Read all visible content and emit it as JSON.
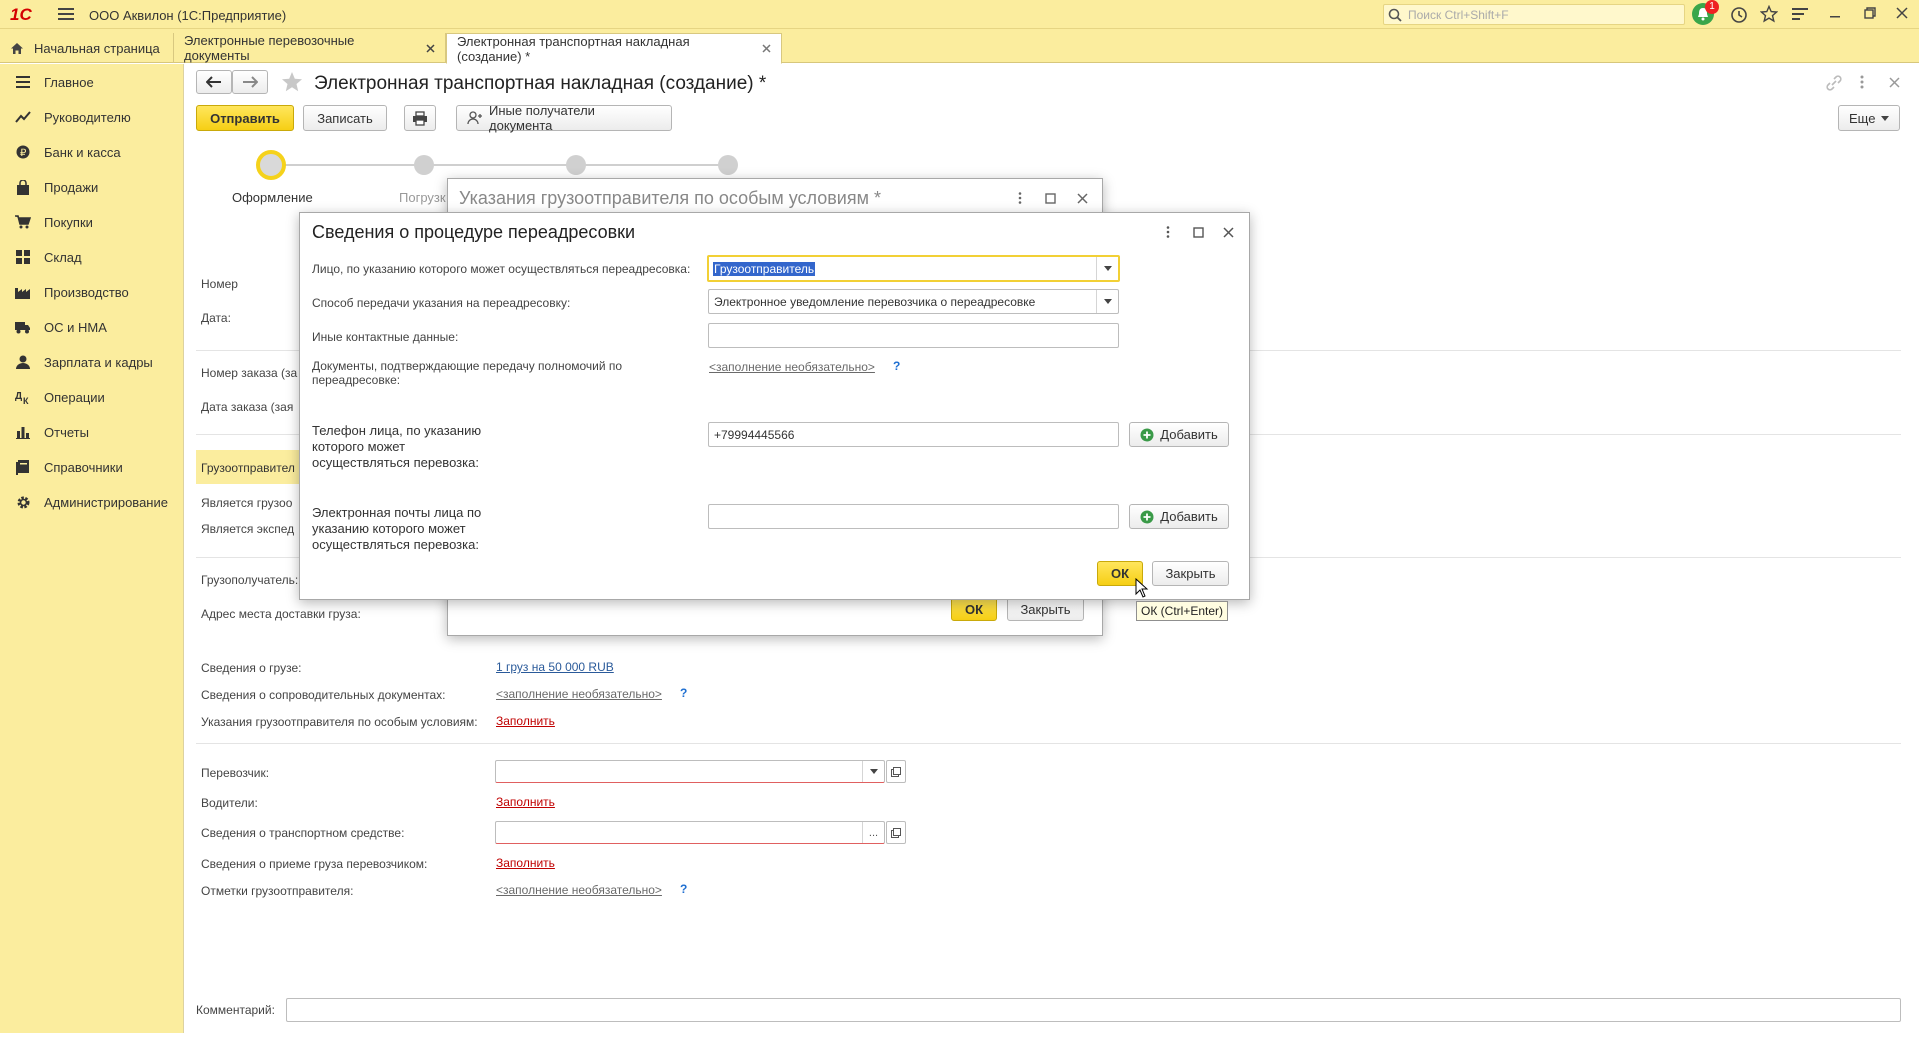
{
  "app": {
    "title": "ООО Аквилон  (1С:Предприятие)",
    "search_placeholder": "Поиск Ctrl+Shift+F",
    "notification_count": "1",
    "logo": "1С"
  },
  "tabs": [
    {
      "label": "Начальная страница"
    },
    {
      "label": "Электронные перевозочные документы"
    },
    {
      "label": "Электронная транспортная накладная (создание) *"
    }
  ],
  "sidebar": {
    "items": [
      {
        "label": "Главное",
        "icon": "menu-icon"
      },
      {
        "label": "Руководителю",
        "icon": "chart-trend-icon"
      },
      {
        "label": "Банк и касса",
        "icon": "coin-icon"
      },
      {
        "label": "Продажи",
        "icon": "bag-icon"
      },
      {
        "label": "Покупки",
        "icon": "cart-icon"
      },
      {
        "label": "Склад",
        "icon": "grid-icon"
      },
      {
        "label": "Производство",
        "icon": "factory-icon"
      },
      {
        "label": "ОС и НМА",
        "icon": "truck-icon"
      },
      {
        "label": "Зарплата и кадры",
        "icon": "person-icon"
      },
      {
        "label": "Операции",
        "icon": "operations-icon"
      },
      {
        "label": "Отчеты",
        "icon": "bar-chart-icon"
      },
      {
        "label": "Справочники",
        "icon": "book-icon"
      },
      {
        "label": "Администрирование",
        "icon": "gear-icon"
      }
    ]
  },
  "doc": {
    "title": "Электронная транспортная накладная (создание) *",
    "send_label": "Отправить",
    "save_label": "Записать",
    "other_recipients_label": "Иные получатели документа",
    "more_label": "Еще",
    "steps": [
      "Оформление",
      "Погрузк"
    ],
    "fields": {
      "number": "Номер",
      "date": "Дата:",
      "order_number": "Номер заказа (за",
      "order_date": "Дата заказа (зая",
      "shipper": "Грузоотправител",
      "is_shipper": "Является грузоо",
      "is_forwarder": "Является экспед",
      "consignee": "Грузополучатель:",
      "delivery_address": "Адрес места доставки груза:"
    },
    "cargo": {
      "label": "Сведения о грузе:",
      "value": "1 груз на 50 000 RUB"
    },
    "accompanying": {
      "label": "Сведения о сопроводительных документах:",
      "value": "<заполнение необязательно>"
    },
    "special": {
      "label": "Указания грузоотправителя по особым условиям:",
      "value": "Заполнить"
    },
    "carrier": {
      "label": "Перевозчик:"
    },
    "drivers": {
      "label": "Водители:",
      "value": "Заполнить"
    },
    "vehicle": {
      "label": "Сведения о транспортном средстве:"
    },
    "acceptance": {
      "label": "Сведения о приеме груза перевозчиком:",
      "value": "Заполнить"
    },
    "shipper_marks": {
      "label": "Отметки грузоотправителя:",
      "value": "<заполнение необязательно>"
    },
    "comment_label": "Комментарий:",
    "q": "?"
  },
  "dialog_back": {
    "title": "Указания грузоотправителя по особым условиям *",
    "ok_label": "ОК",
    "close_label": "Закрыть"
  },
  "dialog": {
    "title": "Сведения о процедуре переадресовки",
    "person_label": "Лицо, по указанию которого может осуществляться переадресовка:",
    "person_value": "Грузоотправитель",
    "method_label": "Способ передачи указания на переадресовку:",
    "method_value": "Электронное уведомление перевозчика о переадресовке",
    "contacts_label": "Иные контактные данные:",
    "contacts_value": "",
    "docs_label": "Документы, подтверждающие передачу полномочий по переадресовке:",
    "docs_value": "<заполнение необязательно>",
    "phone_label": "Телефон лица, по указанию которого может осуществляться перевозка:",
    "phone_value": "+79994445566",
    "email_label": "Электронная почты лица по указанию которого может осуществляться перевозка:",
    "email_value": "",
    "add_label": "Добавить",
    "ok_label": "ОК",
    "close_label": "Закрыть",
    "tooltip": "ОК (Ctrl+Enter)"
  },
  "colors": {
    "accent": "#f6cf14",
    "panel": "#fbed9e",
    "link": "#2a5a9a",
    "required": "#c00000"
  }
}
